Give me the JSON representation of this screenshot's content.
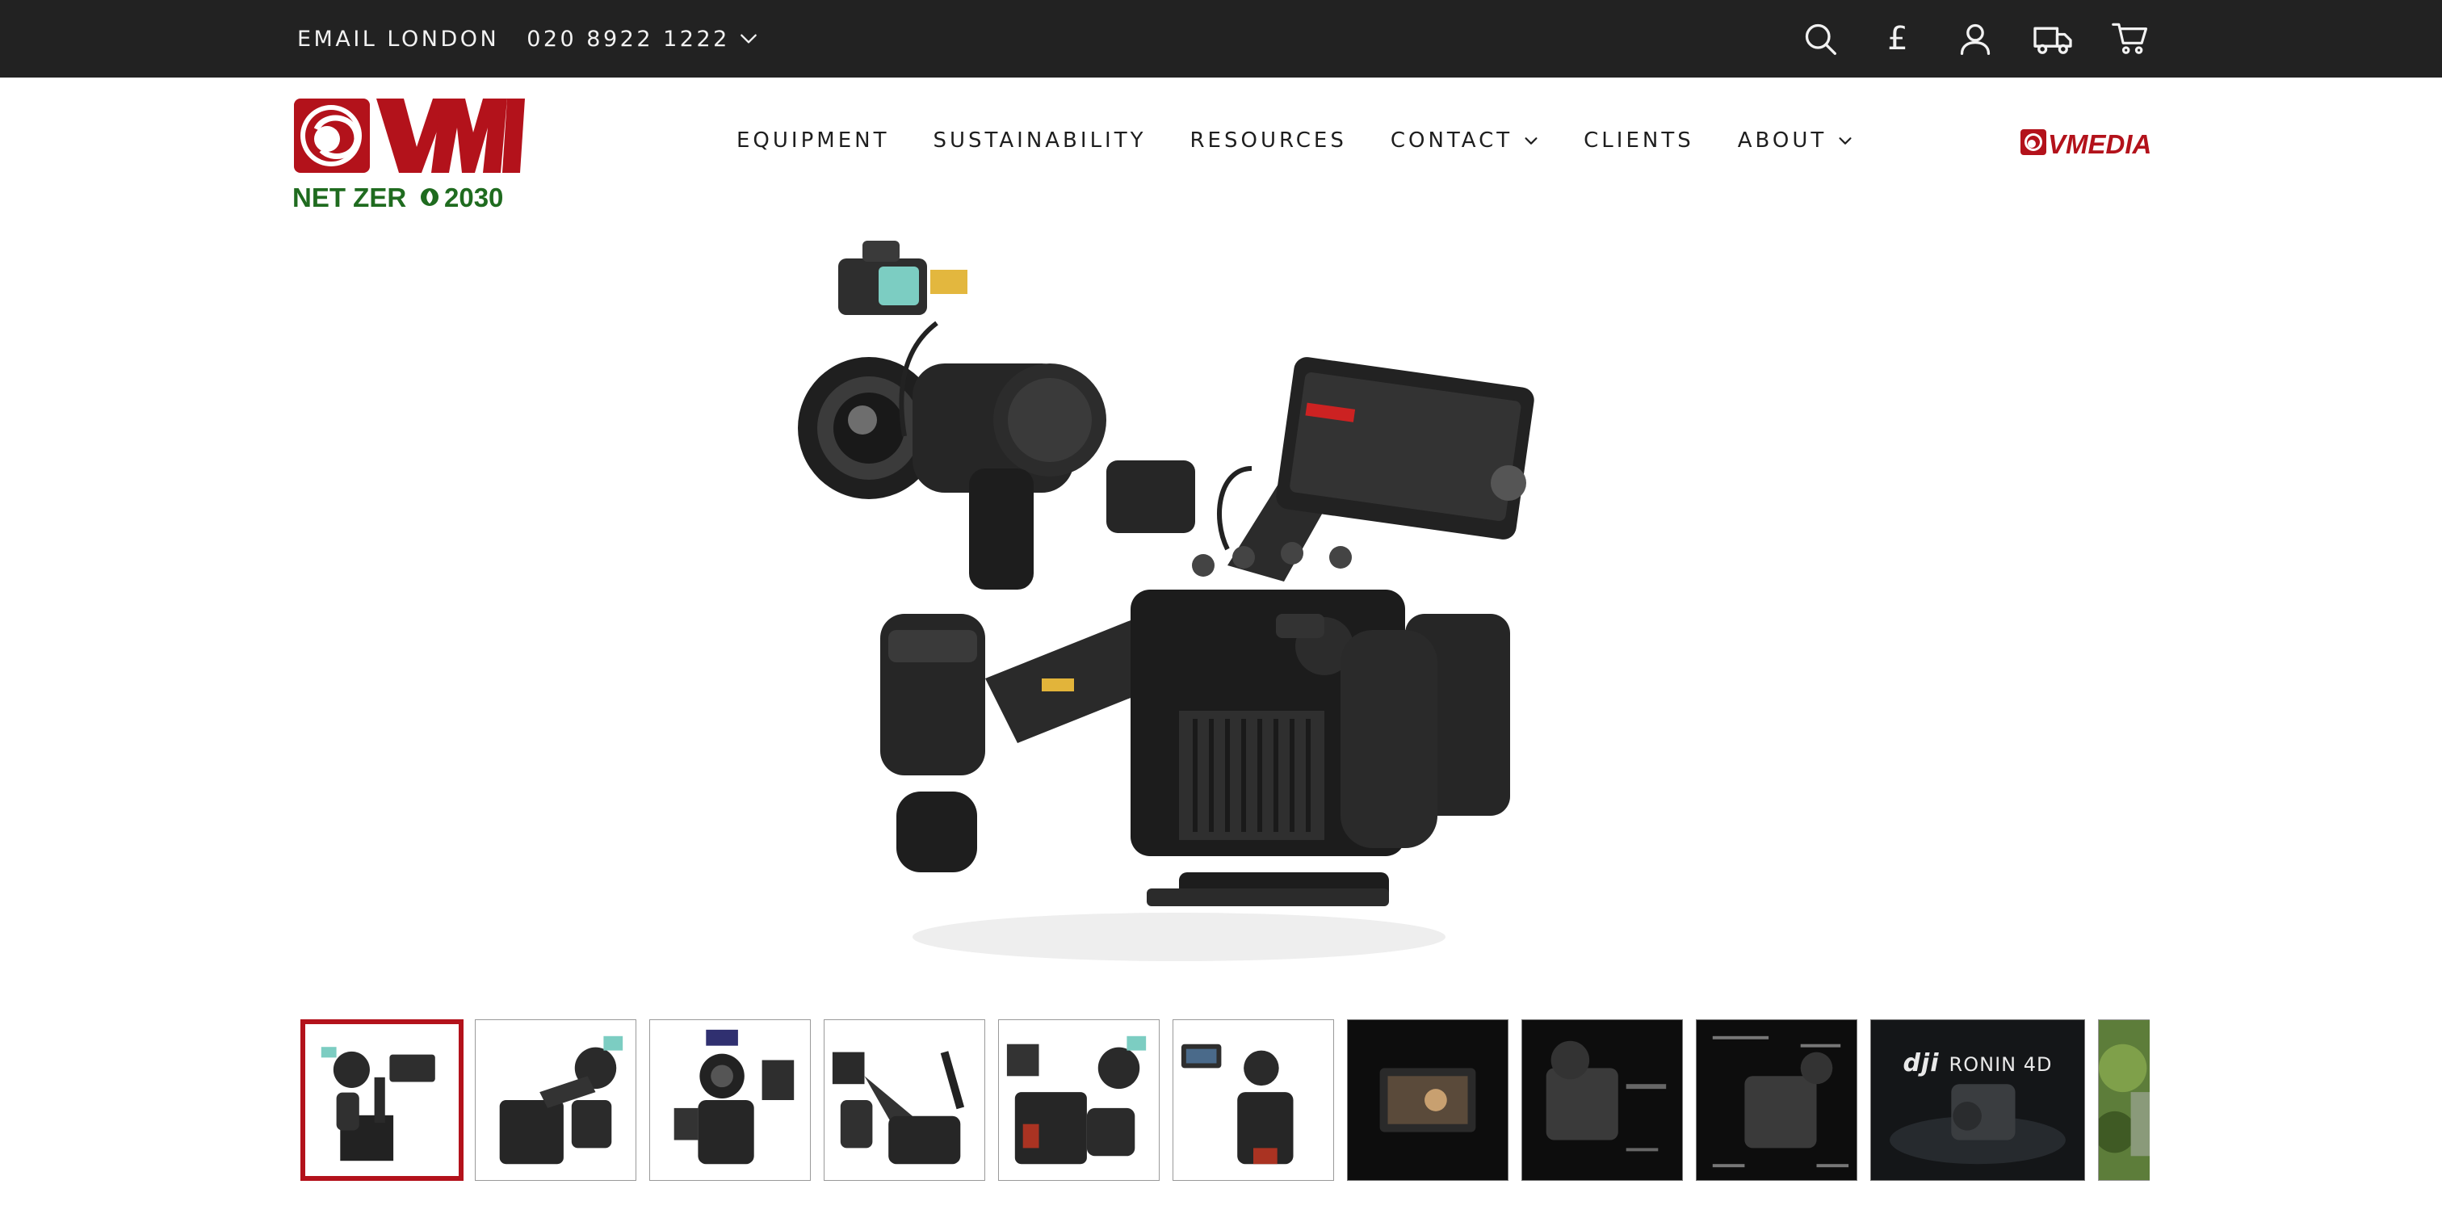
{
  "topbar": {
    "email_label": "EMAIL LONDON",
    "phone_label": "020 8922 1222",
    "icons": [
      "search-icon",
      "currency-pound-icon",
      "account-icon",
      "delivery-truck-icon",
      "cart-icon"
    ],
    "currency_symbol": "£"
  },
  "brand": {
    "logo_text": "VMI",
    "tagline": "NET ZER  2030",
    "tagline_parts": [
      "NET ZER",
      "2030"
    ],
    "logo_color": "#b3121b",
    "tagline_color": "#1f6b1f",
    "partner_logo_text": "VMEDIA"
  },
  "nav": {
    "items": [
      {
        "label": "EQUIPMENT",
        "has_dropdown": false
      },
      {
        "label": "SUSTAINABILITY",
        "has_dropdown": false
      },
      {
        "label": "RESOURCES",
        "has_dropdown": false
      },
      {
        "label": "CONTACT",
        "has_dropdown": true
      },
      {
        "label": "CLIENTS",
        "has_dropdown": false
      },
      {
        "label": "ABOUT",
        "has_dropdown": true
      }
    ]
  },
  "gallery": {
    "selected_index": 0,
    "thumbnail_count": 11,
    "thumb_overlay_text": {
      "brand": "dji",
      "product": "RONIN 4D"
    },
    "accent_color": "#b3121b"
  }
}
